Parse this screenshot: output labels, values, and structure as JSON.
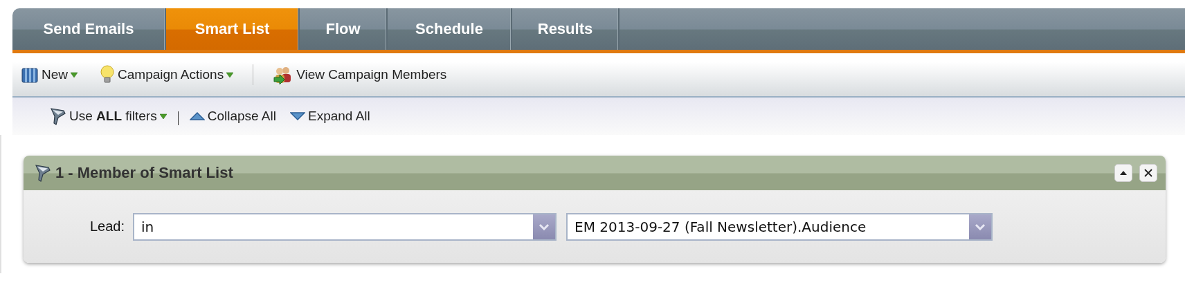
{
  "tabs": [
    {
      "label": "Send Emails",
      "selected": false
    },
    {
      "label": "Smart List",
      "selected": true
    },
    {
      "label": "Flow",
      "selected": false
    },
    {
      "label": "Schedule",
      "selected": false
    },
    {
      "label": "Results",
      "selected": false
    }
  ],
  "toolbar": [
    {
      "kind": "new",
      "label": "New",
      "dropdown": true
    },
    {
      "kind": "actions",
      "label": "Campaign Actions",
      "dropdown": true
    },
    {
      "kind": "separator"
    },
    {
      "kind": "members",
      "label": "View Campaign Members",
      "dropdown": false
    }
  ],
  "filter_toolbar": [
    {
      "kind": "logic",
      "label": "Use **ALL** filters",
      "dropdown": true
    },
    {
      "kind": "separator"
    },
    {
      "kind": "collapse",
      "label": "Collapse All",
      "dropdown": false
    },
    {
      "kind": "expand",
      "label": "Expand All",
      "dropdown": false
    }
  ],
  "filters": [
    {
      "title": "1 - Member of Smart List",
      "field_label": "Lead:",
      "operator": "in",
      "value": "EM 2013-09-27 (Fall Newsletter).Audience"
    }
  ]
}
